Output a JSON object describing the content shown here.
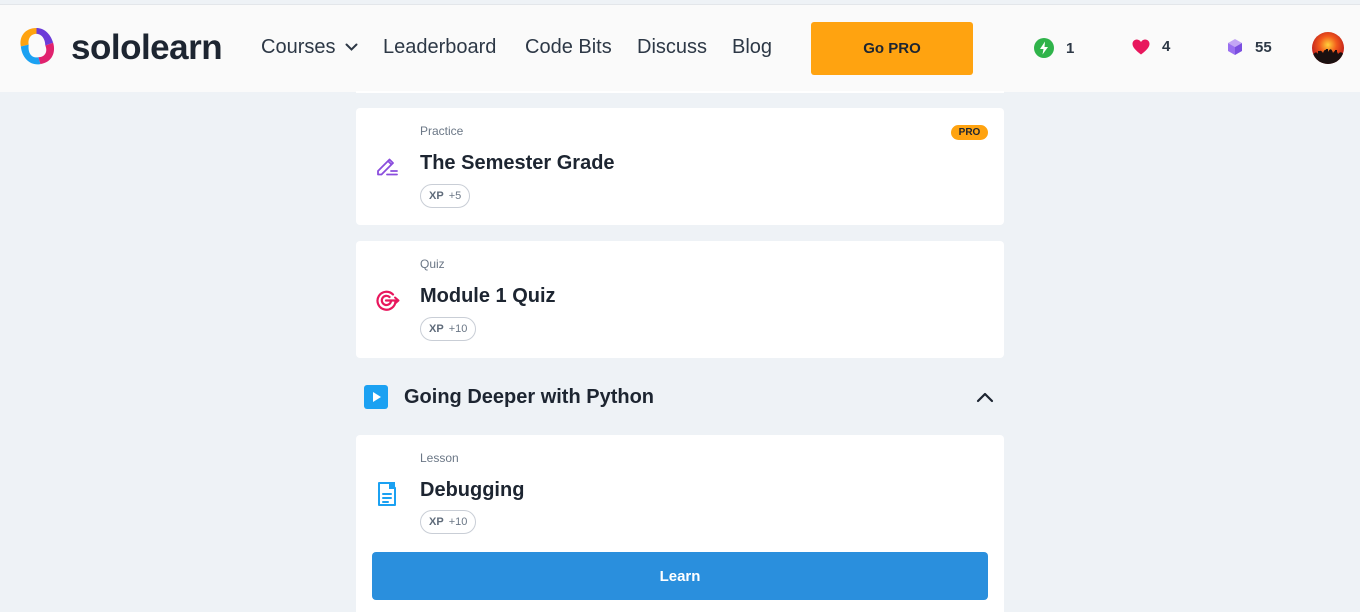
{
  "nav": {
    "logo_text": "sololearn",
    "courses_label": "Courses",
    "leaderboard_label": "Leaderboard",
    "codebits_label": "Code Bits",
    "discuss_label": "Discuss",
    "blog_label": "Blog",
    "go_pro_label": "Go PRO"
  },
  "stats": {
    "streak": "1",
    "hearts": "4",
    "bits": "55"
  },
  "cards": [
    {
      "kind": "Practice",
      "title": "The Semester Grade",
      "xp_label": "XP",
      "xp_value": "+5",
      "badge": "PRO",
      "icon": "pencil-icon"
    },
    {
      "kind": "Quiz",
      "title": "Module 1 Quiz",
      "xp_label": "XP",
      "xp_value": "+10",
      "icon": "target-icon"
    }
  ],
  "module": {
    "title": "Going Deeper with Python",
    "icon": "play-icon"
  },
  "lesson": {
    "kind": "Lesson",
    "title": "Debugging",
    "xp_label": "XP",
    "xp_value": "+10",
    "icon": "document-icon",
    "button_label": "Learn"
  },
  "colors": {
    "accent": "#ffa310",
    "primary_button": "#2a8fdd",
    "background": "#eef2f6"
  }
}
